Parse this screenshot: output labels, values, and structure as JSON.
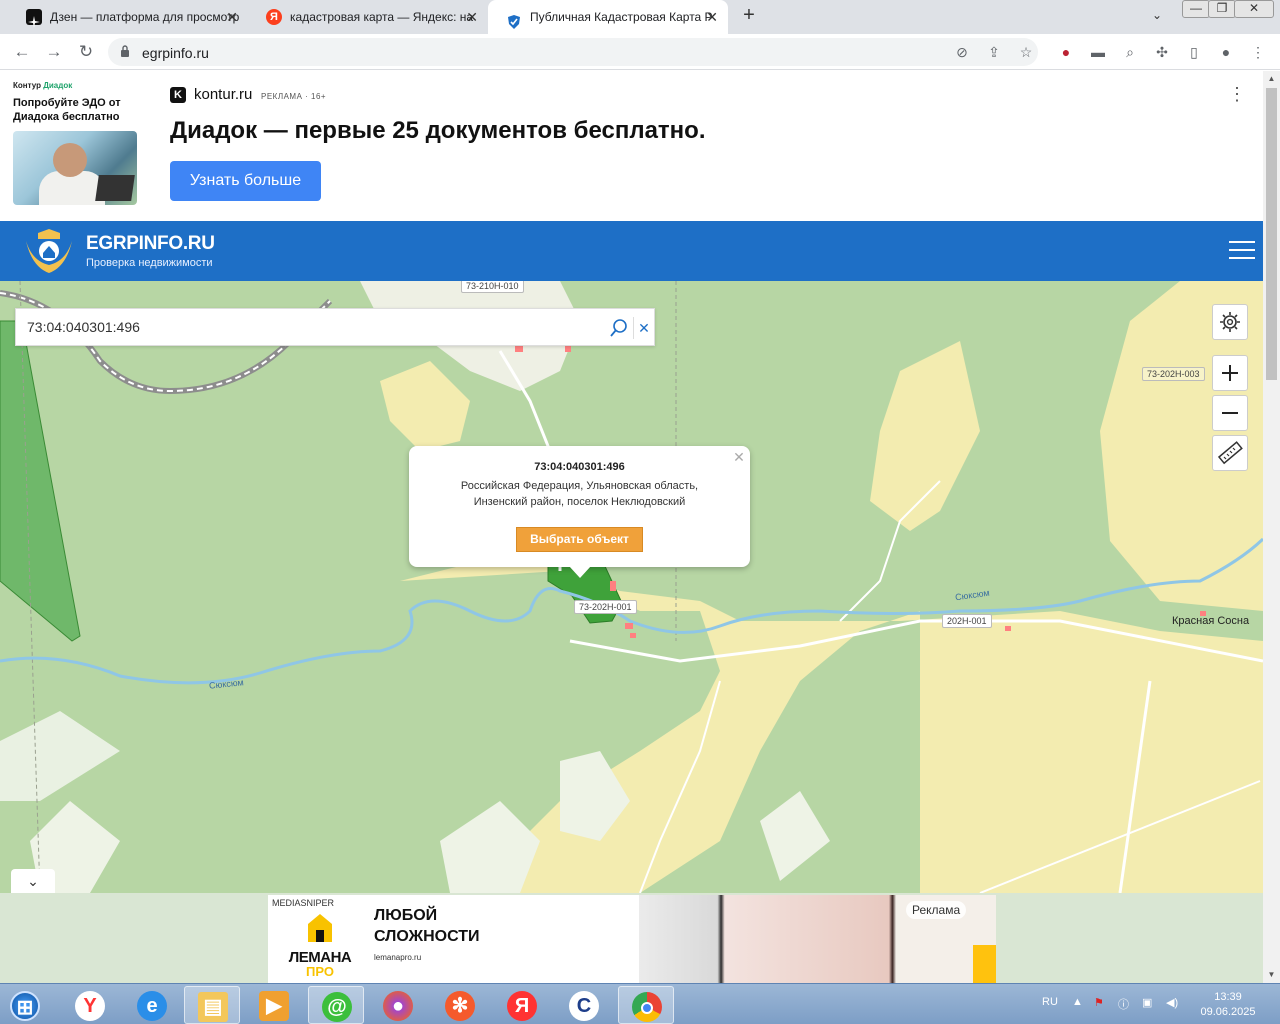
{
  "browser": {
    "tabs": [
      {
        "title": "Дзен — платформа для просмотр",
        "favicon": "dzen-icon"
      },
      {
        "title": "кадастровая карта — Яндекс: на",
        "favicon": "yandex-icon"
      },
      {
        "title": "Публичная Кадастровая Карта Р",
        "favicon": "shield-icon",
        "active": true
      }
    ],
    "url": "egrpinfo.ru"
  },
  "ad": {
    "brand_small_prefix": "Контур",
    "brand_small_name": "Диадок",
    "side_text": "Попробуйте ЭДО от Диадока бесплатно",
    "domain": "kontur.ru",
    "label": "РЕКЛАМА · 16+",
    "headline": "Диадок — первые 25 документов бесплатно.",
    "cta": "Узнать больше",
    "klogo": "K"
  },
  "site": {
    "title": "EGRPINFO.RU",
    "subtitle": "Проверка недвижимости"
  },
  "search": {
    "value": "73:04:040301:496"
  },
  "map": {
    "road_labels": [
      "73-210Н-010",
      "73-202Н-003",
      "73-202Н-001",
      "202Н-001"
    ],
    "place_labels": [
      "Красная Сосна"
    ],
    "river_labels": [
      "Сюксюм",
      "Сюксюм"
    ],
    "colors": {
      "forest": "#b7d6a4",
      "field": "#f3ecb0",
      "river": "#8fc6e6",
      "highlight": "#3fa23a"
    }
  },
  "popup": {
    "number": "73:04:040301:496",
    "address": "Российская Федерация, Ульяновская область, Инзенский район, поселок Неклюдовский",
    "button": "Выбрать объект"
  },
  "bottom_ad": {
    "network": "MEDIASNIPER",
    "brand_line1": "ЛЕМАНА",
    "brand_line2": "ПРО",
    "headline_line1": "ЛЮБОЙ",
    "headline_line2": "СЛОЖНОСТИ",
    "domain": "lemanapro.ru",
    "tag": "Реклама"
  },
  "taskbar": {
    "lang": "RU",
    "time": "13:39",
    "date": "09.06.2025"
  }
}
